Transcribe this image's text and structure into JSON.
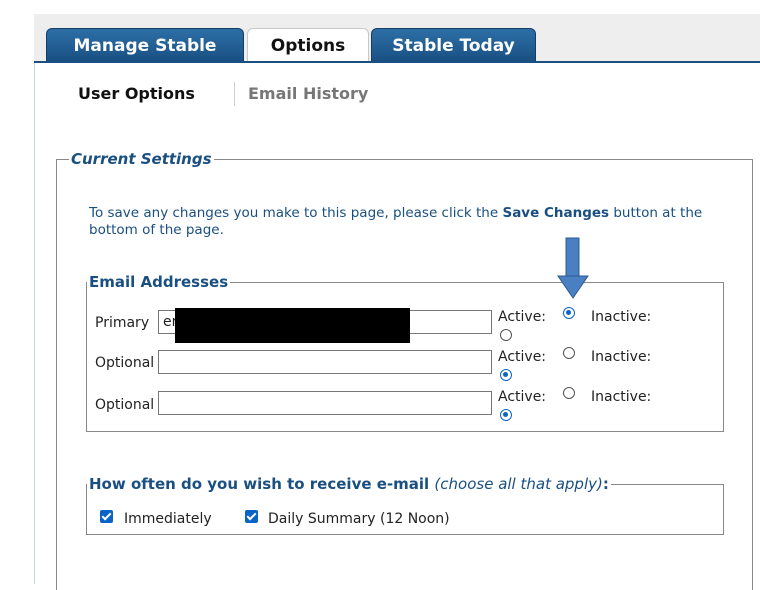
{
  "tabs": [
    {
      "label": "Manage Stable",
      "active": false
    },
    {
      "label": "Options",
      "active": true
    },
    {
      "label": "Stable Today",
      "active": false
    }
  ],
  "subtabs": {
    "user_options": "User Options",
    "email_history": "Email History"
  },
  "current_settings": {
    "legend": "Current Settings",
    "info_before": "To save any changes you make to this page, please click the ",
    "info_bold": "Save Changes",
    "info_after": " button at the bottom of the page."
  },
  "email_addresses": {
    "legend": "Email Addresses",
    "rows": [
      {
        "label": "Primary",
        "value": "er",
        "active_label": "Active:",
        "inactive_label": "Inactive:",
        "status": "active"
      },
      {
        "label": "Optional",
        "value": "",
        "active_label": "Active:",
        "inactive_label": "Inactive:",
        "status": "inactive"
      },
      {
        "label": "Optional",
        "value": "",
        "active_label": "Active:",
        "inactive_label": "Inactive:",
        "status": "inactive"
      }
    ]
  },
  "frequency": {
    "legend": "How often do you wish to receive e-mail",
    "legend_hint": "(choose all that apply)",
    "legend_colon": ":",
    "options": [
      {
        "label": "Immediately",
        "checked": true
      },
      {
        "label": "Daily Summary (12 Noon)",
        "checked": true
      }
    ]
  },
  "colors": {
    "tab_blue": "#1a4f82",
    "accent_text": "#1a4f82",
    "radio_blue": "#0a64c8",
    "arrow": "#4a7fc1"
  }
}
